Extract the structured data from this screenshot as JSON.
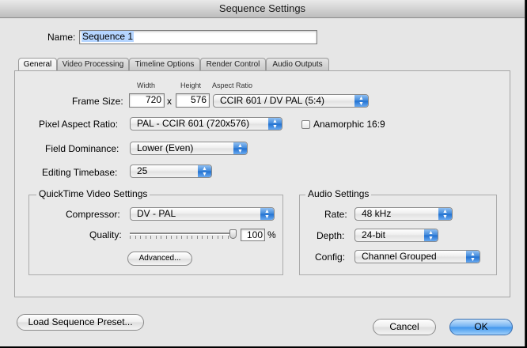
{
  "window": {
    "title": "Sequence Settings"
  },
  "name_label": "Name:",
  "name_value": "Sequence 1",
  "tabs": [
    {
      "label": "General",
      "active": true
    },
    {
      "label": "Video Processing"
    },
    {
      "label": "Timeline Options"
    },
    {
      "label": "Render Control"
    },
    {
      "label": "Audio Outputs"
    }
  ],
  "general": {
    "width_label": "Width",
    "height_label": "Height",
    "aspect_label": "Aspect Ratio",
    "frame_size_label": "Frame Size:",
    "width_value": "720",
    "x_label": "x",
    "height_value": "576",
    "aspect_value": "CCIR 601 / DV PAL (5:4)",
    "pixel_aspect_label": "Pixel Aspect Ratio:",
    "pixel_aspect_value": "PAL - CCIR 601 (720x576)",
    "anamorphic_label": "Anamorphic 16:9",
    "anamorphic_checked": false,
    "field_dominance_label": "Field Dominance:",
    "field_dominance_value": "Lower (Even)",
    "timebase_label": "Editing Timebase:",
    "timebase_value": "25"
  },
  "quicktime": {
    "title": "QuickTime Video Settings",
    "compressor_label": "Compressor:",
    "compressor_value": "DV - PAL",
    "quality_label": "Quality:",
    "quality_value": "100",
    "quality_unit": "%",
    "quality_fraction": 1.0,
    "advanced_label": "Advanced..."
  },
  "audio": {
    "title": "Audio Settings",
    "rate_label": "Rate:",
    "rate_value": "48 kHz",
    "depth_label": "Depth:",
    "depth_value": "24-bit",
    "config_label": "Config:",
    "config_value": "Channel Grouped"
  },
  "buttons": {
    "load_preset": "Load Sequence Preset...",
    "cancel": "Cancel",
    "ok": "OK"
  },
  "colors": {
    "accent": "#3f95ec",
    "selection": "#b5d5ff"
  }
}
